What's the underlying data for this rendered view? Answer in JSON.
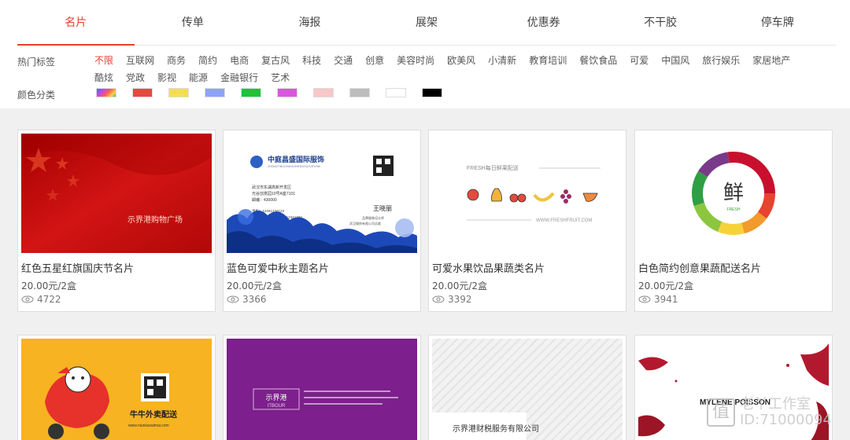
{
  "tabs": [
    "名片",
    "传单",
    "海报",
    "展架",
    "优惠券",
    "不干胶",
    "停车牌"
  ],
  "filters": {
    "hot_label": "热门标签",
    "color_label": "颜色分类",
    "tags": [
      "不限",
      "互联网",
      "商务",
      "简约",
      "电商",
      "复古风",
      "科技",
      "交通",
      "创意",
      "美容时尚",
      "欧美风",
      "小清新",
      "教育培训",
      "餐饮食品",
      "可爱",
      "中国风",
      "旅行娱乐",
      "家居地产",
      "酷炫",
      "党政",
      "影视",
      "能源",
      "金融银行",
      "艺术"
    ],
    "colors": [
      "multicolor",
      "#e8473f",
      "#f3df4c",
      "#8ea3f2",
      "#1ec33a",
      "#d45ad8",
      "#f7c7c9",
      "#bdbdbd",
      "#ffffff",
      "#000000"
    ]
  },
  "cards": [
    {
      "title": "红色五星红旗国庆节名片",
      "price": "20.00元/2盒",
      "views": "4722",
      "thumb": {
        "text": "示界港购物广场"
      }
    },
    {
      "title": "蓝色可爱中秋主题名片",
      "price": "20.00元/2盒",
      "views": "3366",
      "thumb": {
        "company": "中庭昌盛国际服饰",
        "company_en": "ZHONGTINGCHANGSHENGGUOJIFUSHI",
        "addr1": "武汉市东湖高新开发区",
        "addr2": "光谷创意园10号A座7101",
        "zip": "邮编：430000",
        "phone": "手机：12341234123",
        "fax": "传真：027-12341234 12341234",
        "email": "邮箱：shijiegang111@qq.com",
        "name": "王晓丽",
        "role1": "品牌服装设计师",
        "role2": "武汉服饰有限公司总裁"
      }
    },
    {
      "title": "可爱水果饮品果蔬类名片",
      "price": "20.00元/2盒",
      "views": "3392",
      "thumb": {
        "top": "FRESH每日鲜果配送",
        "bottom": "WWW.FRESHFRUIT.COM"
      }
    },
    {
      "title": "白色简约创意果蔬配送名片",
      "price": "20.00元/2盒",
      "views": "3941",
      "thumb": {
        "char": "鲜",
        "sub": "FRESH"
      }
    },
    {
      "title": "",
      "price": "",
      "views": "",
      "thumb": {
        "text": "牛牛外卖配送",
        "url": "www.niuniuwaimai.com"
      }
    },
    {
      "title": "",
      "price": "",
      "views": "",
      "thumb": {
        "brand": "示界港",
        "brand_en": "ITBOUR"
      }
    },
    {
      "title": "",
      "price": "",
      "views": "",
      "thumb": {
        "text": "示界港财税服务有限公司"
      }
    },
    {
      "title": "",
      "price": "",
      "views": "",
      "thumb": {
        "name": "MYLENE POISSON"
      }
    }
  ],
  "watermark": {
    "logo": "值",
    "line1": "老丫工作室",
    "line2": "ID:71000094"
  }
}
